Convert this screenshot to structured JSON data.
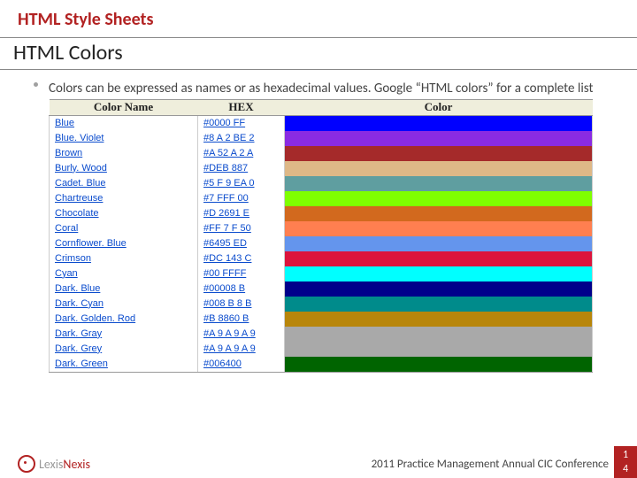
{
  "header": {
    "subtitle": "HTML Style Sheets",
    "title": "HTML Colors"
  },
  "bullet": {
    "text": "Colors can be expressed as names or as hexadecimal values. Google “HTML colors” for a complete list"
  },
  "table": {
    "headers": {
      "name": "Color Name",
      "hex": "HEX",
      "color": "Color"
    },
    "rows": [
      {
        "name": "Blue",
        "hex": "#0000 FF",
        "swatch": "#0000FF"
      },
      {
        "name": "Blue. Violet",
        "hex": "#8 A 2 BE 2",
        "swatch": "#8A2BE2"
      },
      {
        "name": "Brown",
        "hex": "#A 52 A 2 A",
        "swatch": "#A52A2A"
      },
      {
        "name": "Burly. Wood",
        "hex": "#DEB 887",
        "swatch": "#DEB887"
      },
      {
        "name": "Cadet. Blue",
        "hex": "#5 F 9 EA 0",
        "swatch": "#5F9EA0"
      },
      {
        "name": "Chartreuse",
        "hex": "#7 FFF 00",
        "swatch": "#7FFF00"
      },
      {
        "name": "Chocolate",
        "hex": "#D 2691 E",
        "swatch": "#D2691E"
      },
      {
        "name": "Coral",
        "hex": "#FF 7 F 50",
        "swatch": "#FF7F50"
      },
      {
        "name": "Cornflower. Blue",
        "hex": "#6495 ED",
        "swatch": "#6495ED"
      },
      {
        "name": "Crimson",
        "hex": "#DC 143 C",
        "swatch": "#DC143C"
      },
      {
        "name": "Cyan",
        "hex": "#00 FFFF",
        "swatch": "#00FFFF"
      },
      {
        "name": "Dark. Blue",
        "hex": "#00008 B",
        "swatch": "#00008B"
      },
      {
        "name": "Dark. Cyan",
        "hex": "#008 B 8 B",
        "swatch": "#008B8B"
      },
      {
        "name": "Dark. Golden. Rod",
        "hex": "#B 8860 B",
        "swatch": "#B8860B"
      },
      {
        "name": "Dark. Gray",
        "hex": "#A 9 A 9 A 9",
        "swatch": "#A9A9A9"
      },
      {
        "name": "Dark. Grey",
        "hex": "#A 9 A 9 A 9",
        "swatch": "#A9A9A9"
      },
      {
        "name": "Dark. Green",
        "hex": "#006400",
        "swatch": "#006400"
      }
    ]
  },
  "footer": {
    "logo": {
      "part1": "Lexis",
      "part2": "Nexis"
    },
    "conference": "2011 Practice Management Annual CIC Conference",
    "page_line1": "1",
    "page_line2": "4"
  }
}
